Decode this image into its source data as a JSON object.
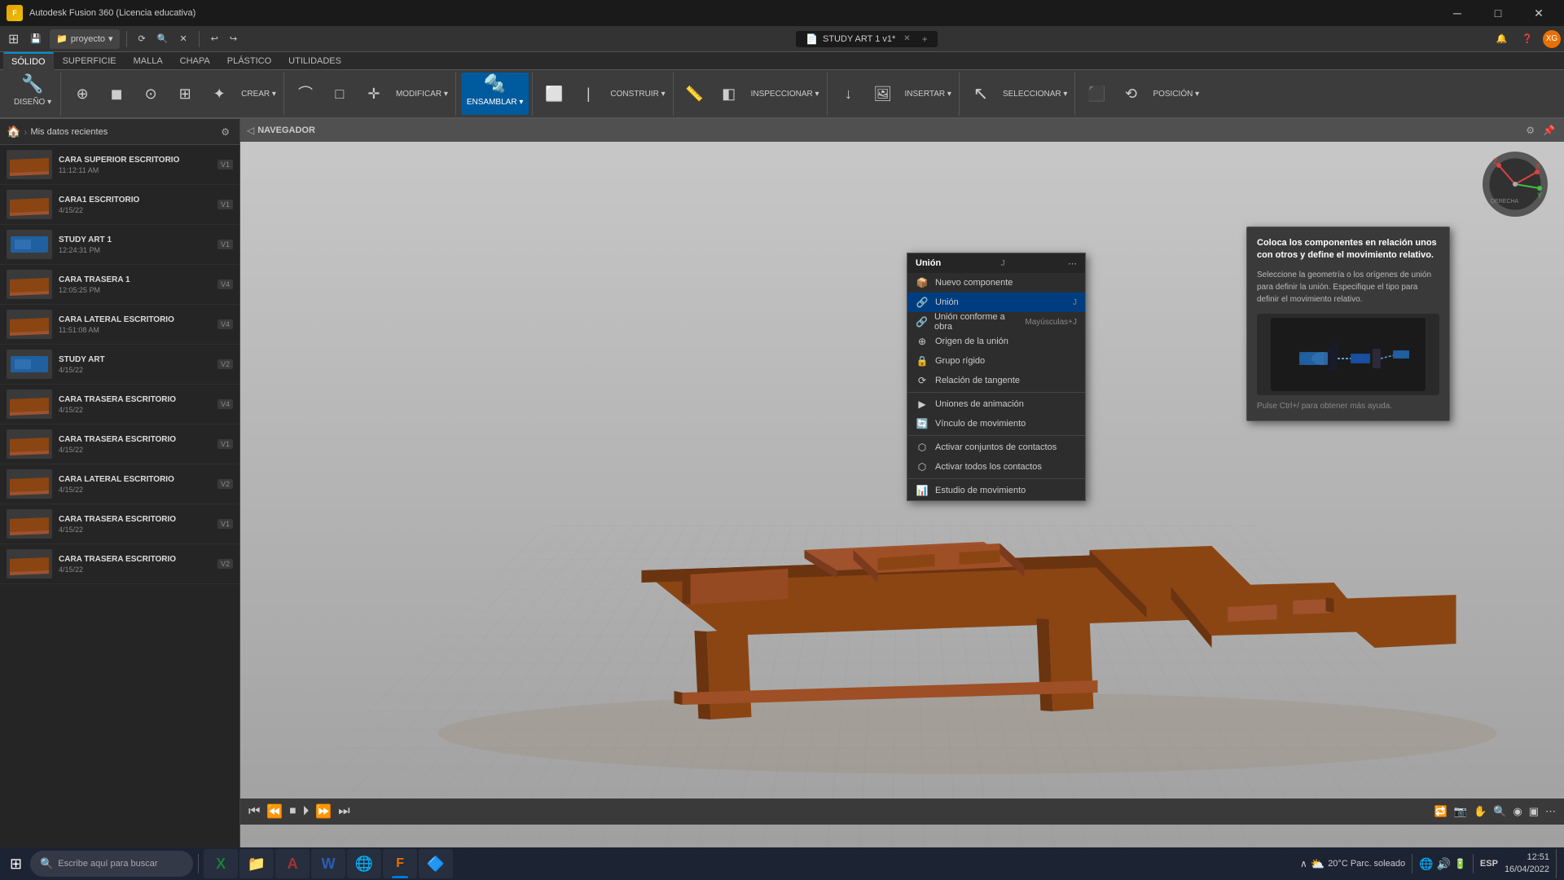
{
  "app": {
    "title": "Autodesk Fusion 360 (Licencia educativa)",
    "document_title": "STUDY ART 1 v1*"
  },
  "titlebar": {
    "app_title": "Autodesk Fusion 360 (Licencia educativa)",
    "minimize": "─",
    "maximize": "□",
    "close": "✕"
  },
  "toolbar_row1": {
    "project_label": "proyecto",
    "buttons": [
      "⟳",
      "🔍",
      "✕"
    ],
    "grid_icon": "⊞",
    "save_icon": "💾",
    "undo_icon": "↩",
    "redo_icon": "↪"
  },
  "ribbon_tabs": {
    "tabs": [
      "SÓLIDO",
      "SUPERFICIE",
      "MALLA",
      "CHAPA",
      "PLÁSTICO",
      "UTILIDADES"
    ],
    "active_tab": "SÓLIDO"
  },
  "ribbon_groups": {
    "diseño": {
      "label": "DISEÑO ▾"
    },
    "crear": {
      "label": "CREAR ▾"
    },
    "modificar": {
      "label": "MODIFICAR ▾"
    },
    "ensamblar": {
      "label": "ENSAMBLAR ▾",
      "active": true
    },
    "construir": {
      "label": "CONSTRUIR ▾"
    },
    "inspeccionar": {
      "label": "INSPECCIONAR ▾"
    },
    "insertar": {
      "label": "INSERTAR ▾"
    },
    "seleccionar": {
      "label": "SELECCIONAR ▾"
    },
    "posicion": {
      "label": "POSICIÓN ▾"
    }
  },
  "ribbon_crear_buttons": [
    {
      "icon": "⊕",
      "label": ""
    },
    {
      "icon": "◼",
      "label": ""
    },
    {
      "icon": "⊙",
      "label": ""
    },
    {
      "icon": "⊞",
      "label": ""
    },
    {
      "icon": "✦",
      "label": ""
    }
  ],
  "navigator": {
    "label": "NAVEGADOR",
    "back_icon": "◁",
    "settings_icon": "⚙",
    "pin_icon": "📌"
  },
  "left_panel": {
    "title": "Mis datos recientes",
    "settings_icon": "⚙",
    "breadcrumb": {
      "home": "🏠",
      "separator": ">",
      "current": "Mis datos recientes"
    },
    "files": [
      {
        "name": "CARA SUPERIOR ESCRITORIO",
        "date": "11:12:11 AM",
        "version": "V1",
        "type": "part"
      },
      {
        "name": "CARA1 ESCRITORIO",
        "date": "4/15/22",
        "version": "V1",
        "type": "part"
      },
      {
        "name": "STUDY ART 1",
        "date": "12:24:31 PM",
        "version": "V1",
        "type": "assembly"
      },
      {
        "name": "CARA TRASERA 1",
        "date": "12:05:25 PM",
        "version": "V4",
        "type": "part"
      },
      {
        "name": "CARA LATERAL ESCRITORIO",
        "date": "11:51:08 AM",
        "version": "V4",
        "type": "part"
      },
      {
        "name": "STUDY ART",
        "date": "4/15/22",
        "version": "V2",
        "type": "assembly"
      },
      {
        "name": "CARA TRASERA ESCRITORIO",
        "date": "4/15/22",
        "version": "V4",
        "type": "part"
      },
      {
        "name": "CARA TRASERA ESCRITORIO",
        "date": "4/15/22",
        "version": "V1",
        "type": "part"
      },
      {
        "name": "CARA LATERAL ESCRITORIO",
        "date": "4/15/22",
        "version": "V2",
        "type": "part"
      },
      {
        "name": "CARA TRASERA ESCRITORIO",
        "date": "4/15/22",
        "version": "V1",
        "type": "part"
      },
      {
        "name": "CARA TRASERA ESCRITORIO",
        "date": "4/15/22",
        "version": "V2",
        "type": "part"
      }
    ]
  },
  "ensamblar_menu": {
    "items": [
      {
        "label": "Nuevo componente",
        "icon": "📦",
        "shortcut": ""
      },
      {
        "label": "Unión",
        "icon": "🔗",
        "shortcut": "J",
        "active": true
      },
      {
        "label": "Unión conforme a obra",
        "icon": "🔗",
        "shortcut": "Mayúsculas+J"
      },
      {
        "label": "Origen de la unión",
        "icon": "⊕",
        "shortcut": ""
      },
      {
        "label": "Grupo rígido",
        "icon": "🔒",
        "shortcut": ""
      },
      {
        "label": "Relación de tangente",
        "icon": "⟳",
        "shortcut": ""
      },
      {
        "label": "Uniones de animación",
        "icon": "▶",
        "shortcut": ""
      },
      {
        "label": "Vínculo de movimiento",
        "icon": "🔄",
        "shortcut": ""
      },
      {
        "label": "Activar conjuntos de contactos",
        "icon": "⬡",
        "shortcut": ""
      },
      {
        "label": "Activar todos los contactos",
        "icon": "⬡",
        "shortcut": ""
      },
      {
        "label": "Estudio de movimiento",
        "icon": "📊",
        "shortcut": ""
      }
    ]
  },
  "tooltip": {
    "title": "Coloca los componentes en relación unos con otros y define el movimiento relativo.",
    "description": "Seleccione la geometría o los orígenes de unión para definir la unión. Especifique el tipo para definir el movimiento relativo.",
    "hint": "Pulse Ctrl+/ para obtener más ayuda."
  },
  "viewport_bottom": {
    "playback_buttons": [
      "⏮",
      "⏪",
      "⏹",
      "⏵",
      "⏩",
      "⏭"
    ],
    "toolbar_icons": [
      "🔁",
      "📷",
      "✋",
      "🔍",
      "◉",
      "▣",
      "⋯"
    ]
  },
  "taskbar": {
    "start_icon": "⊞",
    "search_placeholder": "Escribe aquí para buscar",
    "apps": [
      {
        "icon": "🟢",
        "label": "Excel",
        "active": false
      },
      {
        "icon": "📁",
        "label": "Explorer",
        "active": false
      },
      {
        "icon": "🟣",
        "label": "Access",
        "active": false
      },
      {
        "icon": "🔵",
        "label": "Word",
        "active": false
      },
      {
        "icon": "🌐",
        "label": "Chrome",
        "active": false
      },
      {
        "icon": "🔴",
        "label": "Fusion",
        "active": true
      },
      {
        "icon": "🔷",
        "label": "App",
        "active": false
      }
    ],
    "system": {
      "weather": "20°C  Parc. soleado",
      "time": "12:51",
      "date": "16/04/2022",
      "language": "ESP"
    }
  },
  "colors": {
    "accent": "#0078d4",
    "active_tab": "#005a9e",
    "bg_dark": "#1e1e1e",
    "bg_medium": "#2d2d2d",
    "bg_light": "#3c3c3c",
    "text_primary": "#ffffff",
    "text_secondary": "#cccccc",
    "text_muted": "#888888"
  }
}
